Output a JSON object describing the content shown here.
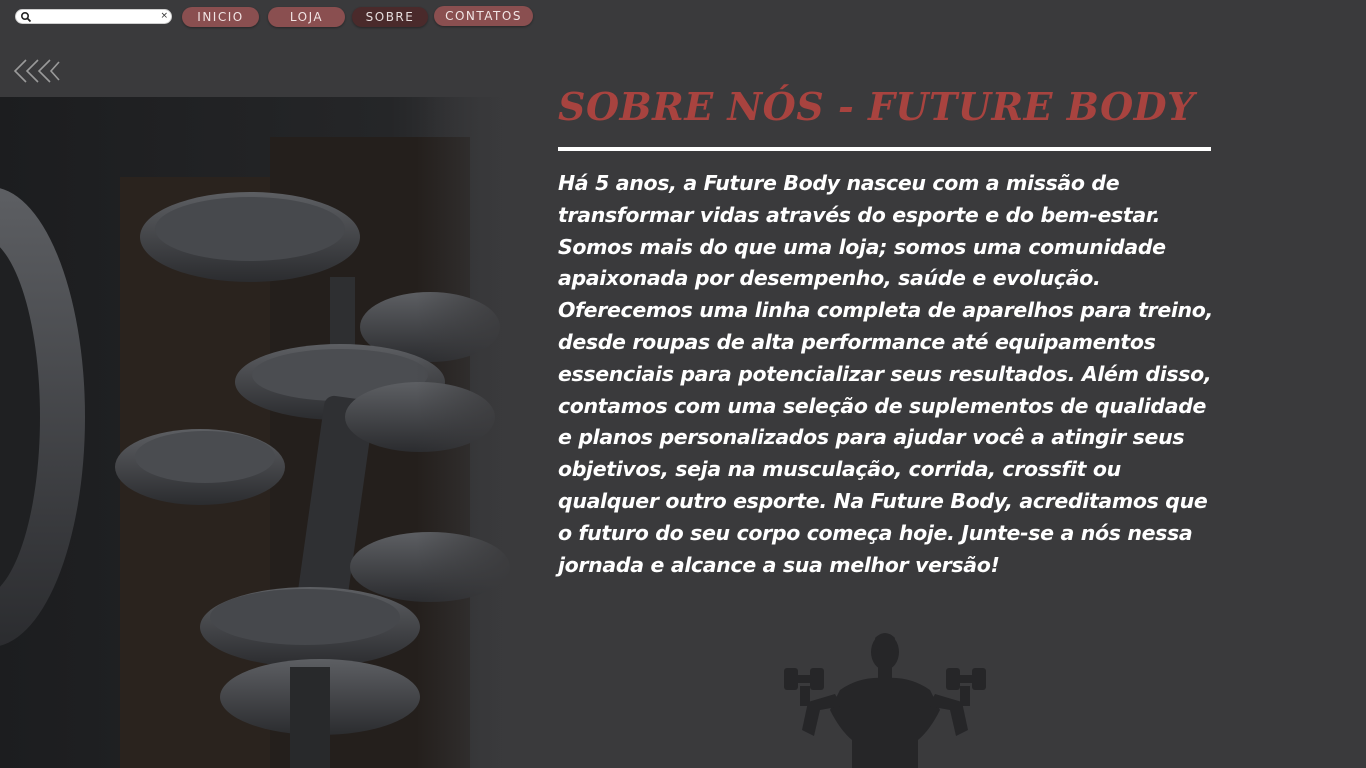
{
  "search": {
    "value": "",
    "placeholder": "",
    "clear_label": "×"
  },
  "nav": {
    "items": [
      {
        "label": "INICIO"
      },
      {
        "label": "LOJA"
      },
      {
        "label": "SOBRE"
      },
      {
        "label": "CONTATOS"
      }
    ],
    "active": "SOBRE"
  },
  "page": {
    "title": "SOBRE NÓS - FUTURE BODY",
    "body": "Há 5 anos, a Future Body nasceu com a missão de transformar vidas através do esporte e do bem-estar. Somos mais do que uma loja; somos uma comunidade apaixonada por desempenho, saúde e evolução. Oferecemos uma linha completa de aparelhos para treino, desde roupas de alta performance até equipamentos essenciais para potencializar seus resultados. Além disso, contamos com uma seleção de suplementos de qualidade e planos personalizados para ajudar você a atingir seus objetivos, seja na musculação, corrida, crossfit ou qualquer outro esporte. Na Future Body, acreditamos que o futuro do seu corpo começa hoje. Junte-se a nós nessa jornada e alcance a sua melhor versão!"
  },
  "icons": {
    "search": "magnifier-icon",
    "back": "triple-chevron-left-icon",
    "decoration": "dumbbell-woman-silhouette-icon"
  },
  "colors": {
    "background": "#3a3a3c",
    "title": "#a8433f",
    "nav_button": "#8a4f50",
    "nav_button_active": "#4a2a2b",
    "text": "#ffffff"
  }
}
